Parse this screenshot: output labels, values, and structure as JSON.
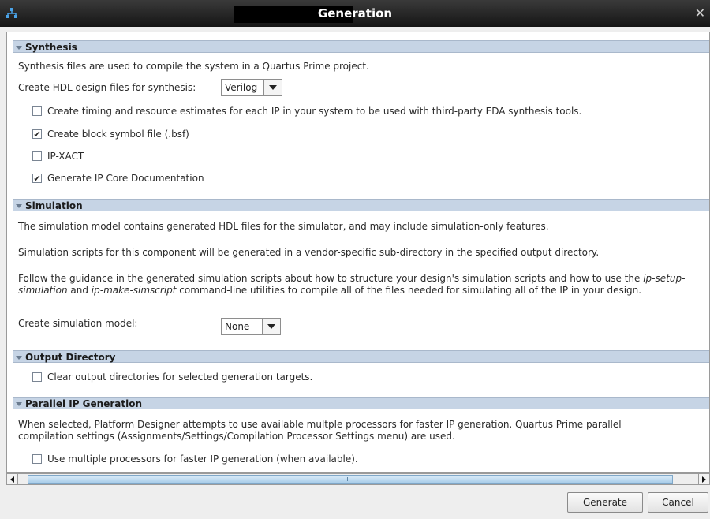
{
  "window": {
    "title": "Generation"
  },
  "sections": {
    "synthesis": {
      "header": "Synthesis",
      "intro": "Synthesis files are used to compile the system in a Quartus Prime project.",
      "hdl_label": "Create HDL design files for synthesis:",
      "hdl_value": "Verilog",
      "checkboxes": [
        {
          "label": "Create timing and resource estimates for each IP in your system to be used with third-party EDA synthesis tools.",
          "checked": false
        },
        {
          "label": "Create block symbol file (.bsf)",
          "checked": true
        },
        {
          "label": "IP-XACT",
          "checked": false
        },
        {
          "label": "Generate IP Core Documentation",
          "checked": true
        }
      ]
    },
    "simulation": {
      "header": "Simulation",
      "p1": "The simulation model contains generated HDL files for the simulator, and may include simulation-only features.",
      "p2": "Simulation scripts for this component will be generated in a vendor-specific sub-directory in the specified output directory.",
      "p3_a": "Follow the guidance in the generated simulation scripts about how to structure your design's simulation scripts and how to use the ",
      "p3_em1": "ip-setup-simulation",
      "p3_b": " and ",
      "p3_em2": "ip-make-simscript",
      "p3_c": " command-line utilities to compile all of the files needed for simulating all of the IP in your design.",
      "model_label": "Create simulation model:",
      "model_value": "None"
    },
    "output": {
      "header": "Output Directory",
      "checkbox": {
        "label": "Clear output directories for selected generation targets.",
        "checked": false
      }
    },
    "parallel": {
      "header": "Parallel IP Generation",
      "desc": "When selected, Platform Designer attempts to use available multple processors for faster IP generation. Quartus Prime parallel compilation settings (Assignments/Settings/Compilation Processor Settings menu) are used.",
      "checkbox": {
        "label": "Use multiple processors for faster IP generation (when available).",
        "checked": false
      }
    }
  },
  "buttons": {
    "generate": "Generate",
    "cancel": "Cancel"
  },
  "icons": {
    "app": "network-icon",
    "close": "close-icon"
  },
  "colors": {
    "section_header": "#c6d4e5",
    "titlebar": "#1e1e1e"
  }
}
